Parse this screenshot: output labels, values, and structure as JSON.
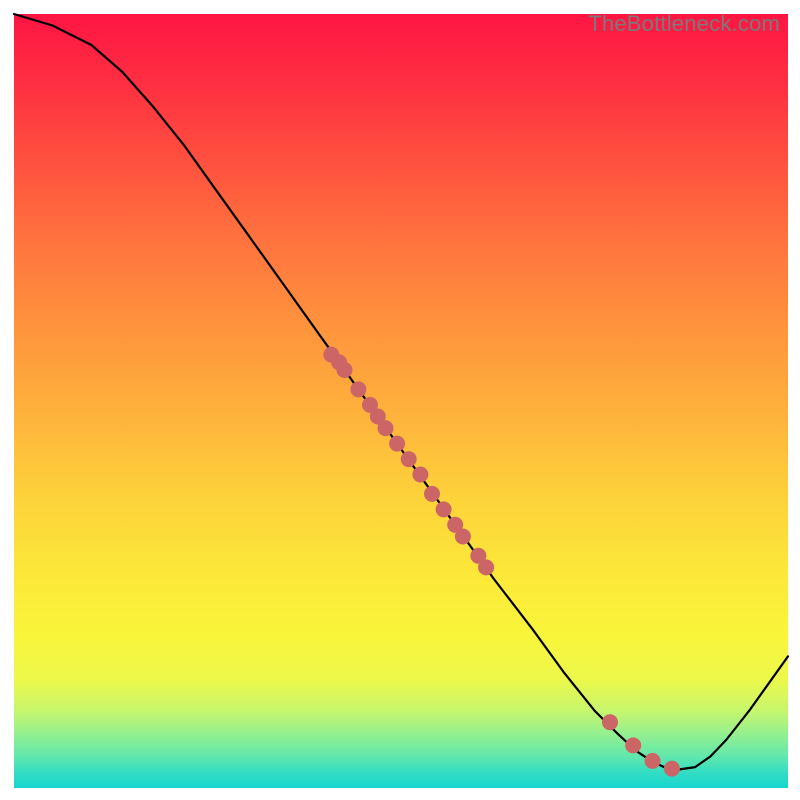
{
  "watermark": {
    "text": "TheBottleneck.com"
  },
  "colors": {
    "curve": "#000000",
    "point_fill": "#cc6666",
    "gradient_top": "#fe1543",
    "gradient_bottom": "#17d6cf"
  },
  "chart_data": {
    "type": "line",
    "title": "",
    "xlabel": "",
    "ylabel": "",
    "xlim": [
      0,
      100
    ],
    "ylim": [
      0,
      100
    ],
    "grid": false,
    "legend": false,
    "curve_points_xy": [
      [
        0,
        100
      ],
      [
        5,
        98.5
      ],
      [
        10,
        96
      ],
      [
        14,
        92.5
      ],
      [
        18,
        88
      ],
      [
        22,
        83
      ],
      [
        27,
        76
      ],
      [
        32,
        69
      ],
      [
        37,
        62
      ],
      [
        42,
        55
      ],
      [
        47,
        48
      ],
      [
        52,
        41
      ],
      [
        57,
        34
      ],
      [
        62,
        27
      ],
      [
        67,
        20.5
      ],
      [
        71,
        15
      ],
      [
        75,
        10
      ],
      [
        78,
        7
      ],
      [
        80.5,
        4.7
      ],
      [
        82.5,
        3.4
      ],
      [
        84,
        2.7
      ],
      [
        86,
        2.4
      ],
      [
        88,
        2.7
      ],
      [
        90,
        4.1
      ],
      [
        92,
        6.2
      ],
      [
        95,
        10
      ],
      [
        100,
        17
      ]
    ],
    "series": [
      {
        "name": "highlighted-points",
        "marker": "circle",
        "color": "#cc6666",
        "points_xy": [
          [
            41.0,
            56.0
          ],
          [
            42.0,
            55.0
          ],
          [
            42.7,
            54.0
          ],
          [
            44.5,
            51.5
          ],
          [
            46.0,
            49.5
          ],
          [
            47.0,
            48.0
          ],
          [
            48.0,
            46.5
          ],
          [
            49.5,
            44.5
          ],
          [
            51.0,
            42.5
          ],
          [
            52.5,
            40.5
          ],
          [
            54.0,
            38.0
          ],
          [
            55.5,
            36.0
          ],
          [
            57.0,
            34.0
          ],
          [
            58.0,
            32.5
          ],
          [
            60.0,
            30.0
          ],
          [
            61.0,
            28.5
          ],
          [
            77.0,
            8.5
          ],
          [
            80.0,
            5.5
          ],
          [
            82.5,
            3.5
          ],
          [
            85.0,
            2.5
          ]
        ]
      }
    ]
  }
}
